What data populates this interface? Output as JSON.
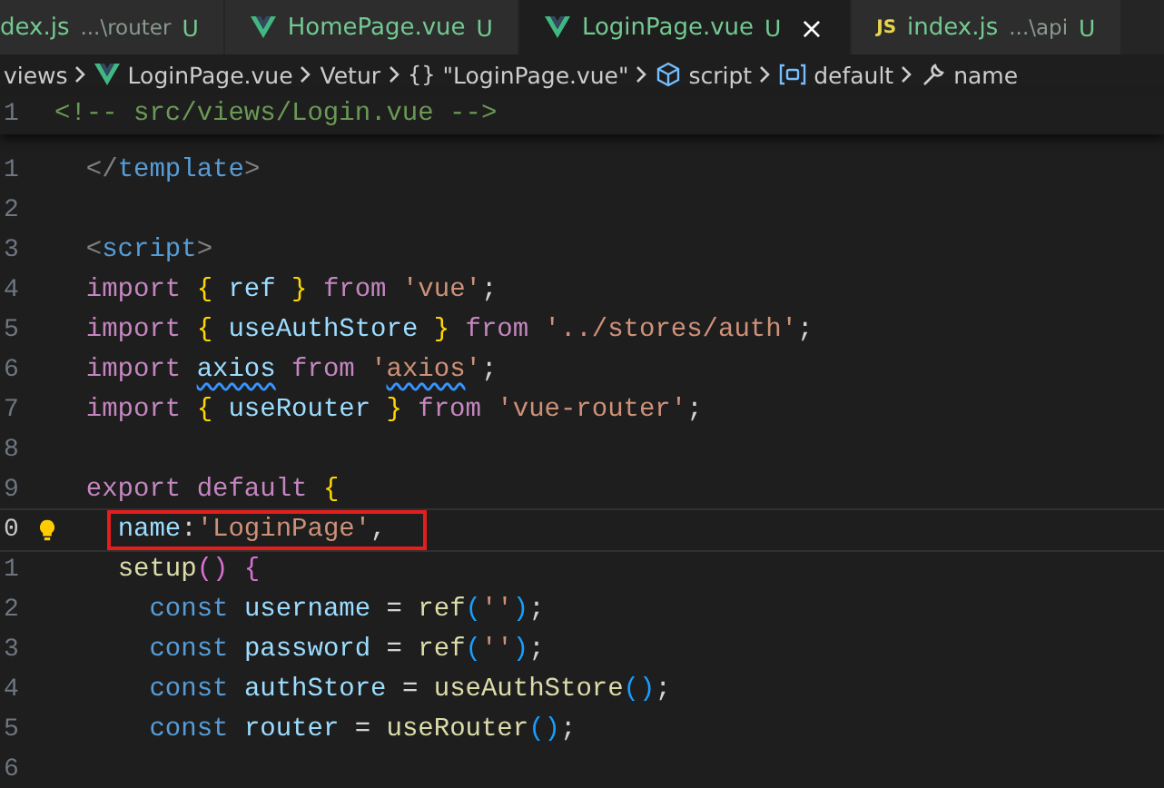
{
  "tabs": [
    {
      "name": "dex.js",
      "description": "...\\router",
      "status": "U",
      "selected": false
    },
    {
      "name": "HomePage.vue",
      "status": "U",
      "kind": "vue",
      "selected": false
    },
    {
      "name": "LoginPage.vue",
      "status": "U",
      "kind": "vue",
      "selected": true,
      "close": "×"
    },
    {
      "name": "index.js",
      "description": "...\\api",
      "status": "U",
      "kind": "js",
      "icon_text": "JS",
      "selected": false
    }
  ],
  "breadcrumbs": [
    {
      "kind": "folder",
      "label": "views"
    },
    {
      "kind": "vue",
      "label": "LoginPage.vue"
    },
    {
      "kind": "plain",
      "label": "Vetur"
    },
    {
      "kind": "object",
      "glyph": "{}",
      "label": "\"LoginPage.vue\""
    },
    {
      "kind": "module",
      "label": "script"
    },
    {
      "kind": "variable",
      "label": "default"
    },
    {
      "kind": "property",
      "label": "name"
    }
  ],
  "sticky_line": {
    "number": "1",
    "tokens": [
      {
        "kind": "comment",
        "t": "<!-- src/views/Login.vue -->"
      }
    ]
  },
  "lines": [
    {
      "number": "1",
      "tokens": [
        {
          "kind": "tag",
          "t": "  </"
        },
        {
          "kind": "tagname",
          "t": "template"
        },
        {
          "kind": "tag",
          "t": ">"
        }
      ]
    },
    {
      "number": "2"
    },
    {
      "number": "3",
      "tokens": [
        {
          "kind": "tag",
          "t": "  <"
        },
        {
          "kind": "tagname",
          "t": "script"
        },
        {
          "kind": "tag",
          "t": ">"
        }
      ]
    },
    {
      "number": "4",
      "tokens": [
        {
          "kind": "control",
          "t": "  import "
        },
        {
          "kind": "brace1",
          "t": "{"
        },
        {
          "kind": "variable",
          "t": " ref "
        },
        {
          "kind": "brace1",
          "t": "}"
        },
        {
          "kind": "control",
          "t": " from "
        },
        {
          "kind": "string",
          "t": "'vue'"
        },
        {
          "kind": "punct",
          "t": ";"
        }
      ]
    },
    {
      "number": "5",
      "tokens": [
        {
          "kind": "control",
          "t": "  import "
        },
        {
          "kind": "brace1",
          "t": "{"
        },
        {
          "kind": "variable",
          "t": " useAuthStore "
        },
        {
          "kind": "brace1",
          "t": "}"
        },
        {
          "kind": "control",
          "t": " from "
        },
        {
          "kind": "string",
          "t": "'../stores/auth'"
        },
        {
          "kind": "punct",
          "t": ";"
        }
      ]
    },
    {
      "number": "6",
      "tokens": [
        {
          "kind": "control",
          "t": "  import "
        },
        {
          "kind": "variable",
          "t": "axios",
          "squiggle": true
        },
        {
          "kind": "control",
          "t": " from "
        },
        {
          "kind": "string",
          "t": "'"
        },
        {
          "kind": "string",
          "t": "axios",
          "squiggle": true
        },
        {
          "kind": "string",
          "t": "'"
        },
        {
          "kind": "punct",
          "t": ";"
        }
      ]
    },
    {
      "number": "7",
      "tokens": [
        {
          "kind": "control",
          "t": "  import "
        },
        {
          "kind": "brace1",
          "t": "{"
        },
        {
          "kind": "variable",
          "t": " useRouter "
        },
        {
          "kind": "brace1",
          "t": "}"
        },
        {
          "kind": "control",
          "t": " from "
        },
        {
          "kind": "string",
          "t": "'vue-router'"
        },
        {
          "kind": "punct",
          "t": ";"
        }
      ]
    },
    {
      "number": "8"
    },
    {
      "number": "9",
      "tokens": [
        {
          "kind": "control",
          "t": "  export default "
        },
        {
          "kind": "brace1",
          "t": "{"
        }
      ]
    },
    {
      "number": "0",
      "current": true,
      "lightbulb": true,
      "boxed": true,
      "tokens": [
        {
          "kind": "variable",
          "t": "    name"
        },
        {
          "kind": "punct",
          "t": ":"
        },
        {
          "kind": "string",
          "t": "'LoginPage'"
        },
        {
          "kind": "punct",
          "t": ","
        }
      ]
    },
    {
      "number": "1",
      "tokens": [
        {
          "kind": "func",
          "t": "    setup"
        },
        {
          "kind": "brace2",
          "t": "()"
        },
        {
          "kind": "brace2",
          "t": " {"
        }
      ]
    },
    {
      "number": "2",
      "tokens": [
        {
          "kind": "keyword",
          "t": "      const "
        },
        {
          "kind": "variable",
          "t": "username"
        },
        {
          "kind": "punct",
          "t": " = "
        },
        {
          "kind": "func",
          "t": "ref"
        },
        {
          "kind": "brace3",
          "t": "("
        },
        {
          "kind": "string",
          "t": "''"
        },
        {
          "kind": "brace3",
          "t": ")"
        },
        {
          "kind": "punct",
          "t": ";"
        }
      ]
    },
    {
      "number": "3",
      "tokens": [
        {
          "kind": "keyword",
          "t": "      const "
        },
        {
          "kind": "variable",
          "t": "password"
        },
        {
          "kind": "punct",
          "t": " = "
        },
        {
          "kind": "func",
          "t": "ref"
        },
        {
          "kind": "brace3",
          "t": "("
        },
        {
          "kind": "string",
          "t": "''"
        },
        {
          "kind": "brace3",
          "t": ")"
        },
        {
          "kind": "punct",
          "t": ";"
        }
      ]
    },
    {
      "number": "4",
      "tokens": [
        {
          "kind": "keyword",
          "t": "      const "
        },
        {
          "kind": "variable",
          "t": "authStore"
        },
        {
          "kind": "punct",
          "t": " = "
        },
        {
          "kind": "func",
          "t": "useAuthStore"
        },
        {
          "kind": "brace3",
          "t": "()"
        },
        {
          "kind": "punct",
          "t": ";"
        }
      ]
    },
    {
      "number": "5",
      "tokens": [
        {
          "kind": "keyword",
          "t": "      const "
        },
        {
          "kind": "variable",
          "t": "router"
        },
        {
          "kind": "punct",
          "t": " = "
        },
        {
          "kind": "func",
          "t": "useRouter"
        },
        {
          "kind": "brace3",
          "t": "()"
        },
        {
          "kind": "punct",
          "t": ";"
        }
      ]
    },
    {
      "number": "6"
    }
  ]
}
